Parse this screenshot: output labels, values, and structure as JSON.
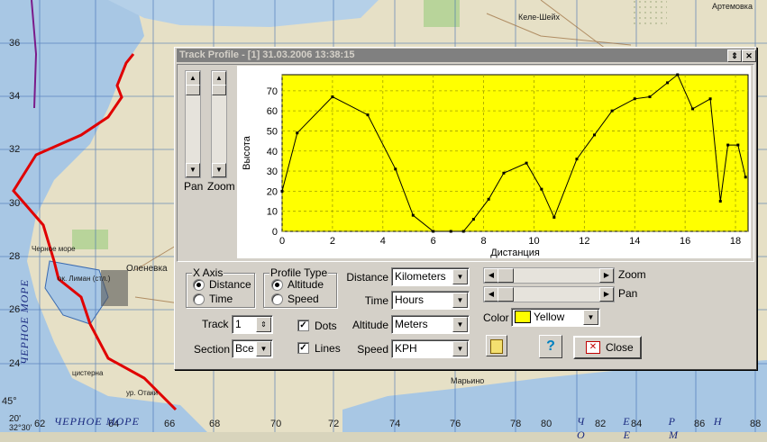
{
  "map": {
    "lat_labels": [
      "36",
      "34",
      "32",
      "30",
      "28",
      "26",
      "24"
    ],
    "lon_labels": [
      "62",
      "64",
      "66",
      "68",
      "70",
      "72",
      "74",
      "76",
      "78",
      "80",
      "82",
      "84",
      "86",
      "88"
    ],
    "corner_labels": [
      "20'",
      "32°30'"
    ],
    "left_edge_label": "45°",
    "place_labels": [
      "Оленевка",
      "Артемовка",
      "Марьино",
      "Келе-Шейх",
      "цистерна",
      "ур. Отаки",
      "ок. Лиман (стл.)",
      "Черное море"
    ],
    "sea_label_bottom": "ЧЕРНОЕ МОРЕ",
    "sea_label_left": "ЧЕРНОЕ МОРЕ",
    "sea_label_right": "Ч Е Р Н О Е  М",
    "colors": {
      "sea": "#a8c7e4",
      "land": "#e6e0c6",
      "track": "#e00000",
      "grid": "#3a6ab0"
    }
  },
  "dialog": {
    "title": "Track Profile - [1] 31.03.2006 13:38:15",
    "restore_icon": "restore-icon",
    "close_icon": "close-icon",
    "pan_label": "Pan",
    "zoom_label": "Zoom",
    "x_axis": {
      "title": "X Axis",
      "options": [
        "Distance",
        "Time"
      ],
      "selected": "Distance"
    },
    "profile_type": {
      "title": "Profile Type",
      "options": [
        "Altitude",
        "Speed"
      ],
      "selected": "Altitude"
    },
    "track": {
      "label": "Track",
      "value": "1"
    },
    "section": {
      "label": "Section",
      "value": "Все"
    },
    "dots": {
      "label": "Dots",
      "checked": true
    },
    "lines": {
      "label": "Lines",
      "checked": true
    },
    "units": [
      {
        "label": "Distance",
        "value": "Kilometers"
      },
      {
        "label": "Time",
        "value": "Hours"
      },
      {
        "label": "Altitude",
        "value": "Meters"
      },
      {
        "label": "Speed",
        "value": "KPH"
      }
    ],
    "zoom_label2": "Zoom",
    "pan_label2": "Pan",
    "color": {
      "label": "Color",
      "value": "Yellow",
      "swatch": "#ffff00"
    },
    "close_label": "Close",
    "help_label": "?"
  },
  "chart_data": {
    "type": "line",
    "xlabel": "Дистанция",
    "ylabel": "Высота",
    "xlim": [
      0,
      18.5
    ],
    "ylim": [
      0,
      78
    ],
    "x_ticks": [
      0,
      2,
      4,
      6,
      8,
      10,
      12,
      14,
      16,
      18
    ],
    "y_ticks": [
      0,
      10,
      20,
      30,
      40,
      50,
      60,
      70
    ],
    "grid": true,
    "background": "#ffff00",
    "x": [
      0,
      0.6,
      2.0,
      3.4,
      4.5,
      5.2,
      6.0,
      6.7,
      7.2,
      7.6,
      8.2,
      8.8,
      9.7,
      10.3,
      10.8,
      11.7,
      12.4,
      13.1,
      14.0,
      14.6,
      15.3,
      15.7,
      16.3,
      17.0,
      17.4,
      17.7,
      18.1,
      18.4
    ],
    "y": [
      20,
      49,
      67,
      58,
      31,
      8,
      0,
      0,
      0,
      6,
      16,
      29,
      34,
      21,
      7,
      36,
      48,
      60,
      66,
      67,
      74,
      78,
      61,
      66,
      15,
      43,
      43,
      27
    ]
  }
}
